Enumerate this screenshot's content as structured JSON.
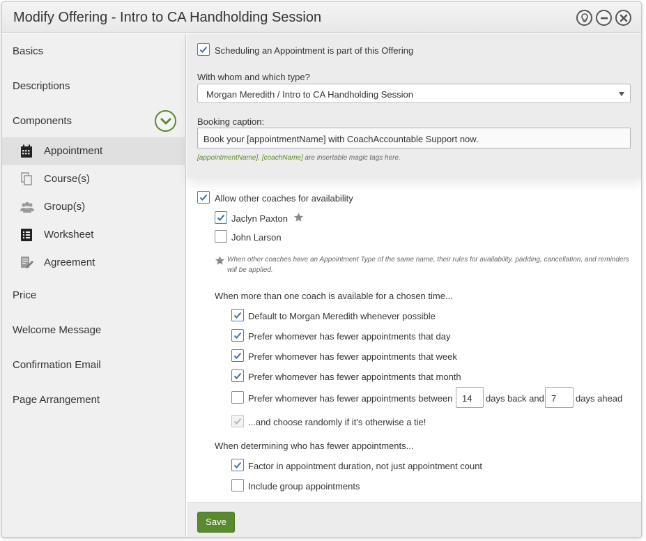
{
  "window": {
    "title": "Modify Offering - Intro to CA Handholding Session"
  },
  "title_icons": [
    "lightbulb-icon",
    "minimize-icon",
    "close-icon"
  ],
  "sidebar": {
    "items": [
      {
        "label": "Basics"
      },
      {
        "label": "Descriptions"
      },
      {
        "label": "Components"
      },
      {
        "label": "Price"
      },
      {
        "label": "Welcome Message"
      },
      {
        "label": "Confirmation Email"
      },
      {
        "label": "Page Arrangement"
      }
    ],
    "components": [
      {
        "label": "Appointment",
        "icon": "calendar-icon",
        "active": true
      },
      {
        "label": "Course(s)",
        "icon": "documents-icon",
        "active": false
      },
      {
        "label": "Group(s)",
        "icon": "group-icon",
        "active": false
      },
      {
        "label": "Worksheet",
        "icon": "worksheet-icon",
        "active": false
      },
      {
        "label": "Agreement",
        "icon": "agreement-icon",
        "active": false
      }
    ]
  },
  "main": {
    "scheduling_label": "Scheduling an Appointment is part of this Offering",
    "scheduling_checked": true,
    "with_whom_label": "With whom and which type?",
    "with_whom_value": "Morgan Meredith / Intro to CA Handholding Session",
    "booking_caption_label": "Booking caption:",
    "booking_caption_value": "Book your [appointmentName] with CoachAccountable Support now.",
    "hint_tag1": "[appointmentName]",
    "hint_sep": ", ",
    "hint_tag2": "[coachName]",
    "hint_rest": " are insertable magic tags here.",
    "allow_other_label": "Allow other coaches for availability",
    "coaches": [
      {
        "name": "Jaclyn Paxton",
        "checked": true
      },
      {
        "name": "John Larson",
        "checked": false
      }
    ],
    "note": "When other coaches have an Appointment Type of the same name, their rules for availability, padding, cancellation, and reminders will be applied.",
    "more_than_one_label": "When more than one coach is available for a chosen time...",
    "rules": [
      {
        "label": "Default to Morgan Meredith whenever possible",
        "checked": true
      },
      {
        "label": "Prefer whomever has fewer appointments that day",
        "checked": true
      },
      {
        "label": "Prefer whomever has fewer appointments that week",
        "checked": true
      },
      {
        "label": "Prefer whomever has fewer appointments that month",
        "checked": true
      }
    ],
    "between_label": "Prefer whomever has fewer appointments between",
    "days_back_value": "14",
    "days_back_label": "days back and",
    "days_ahead_value": "7",
    "days_ahead_label": "days ahead",
    "random_label": "...and choose randomly if it's otherwise a tie!",
    "fewer_label": "When determining who has fewer appointments...",
    "factor_label": "Factor in appointment duration, not just appointment count",
    "group_label": "Include group appointments",
    "save_label": "Save"
  },
  "colors": {
    "accent_green": "#5a8a2e",
    "check_blue": "#4a7fb5",
    "tag_green": "#5b8c2a"
  }
}
